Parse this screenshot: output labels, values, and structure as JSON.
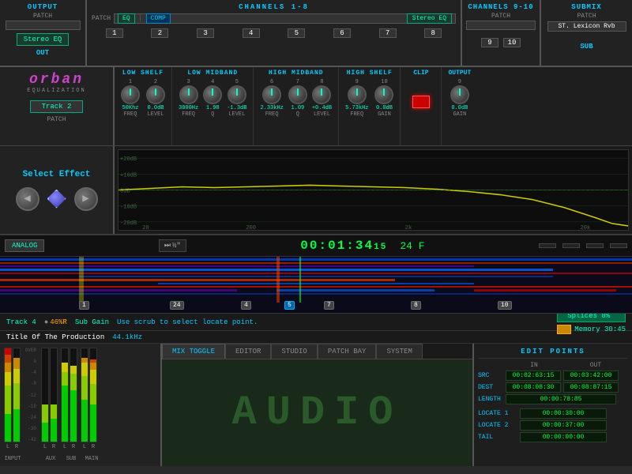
{
  "output": {
    "title": "OUTPUT",
    "patch_label": "PATCH",
    "patch_value": "",
    "eq_label": "Stereo EQ",
    "out_label": "OUT"
  },
  "channels_1_8": {
    "title": "CHANNELS 1-8",
    "patch_label": "PATCH",
    "eq_label": "EQ",
    "comp_label": "COMP",
    "stereo_eq": "Stereo EQ",
    "channels": [
      "1",
      "2",
      "3",
      "4",
      "5",
      "6",
      "7",
      "8"
    ]
  },
  "channels_9_10": {
    "title": "CHANNELS 9-10",
    "patch_label": "PATCH",
    "channels": [
      "9",
      "10"
    ]
  },
  "submix": {
    "title": "SUBMIX",
    "patch_label": "PATCH",
    "value": "ST. Lexicon Rvb",
    "sub_label": "SUB"
  },
  "orban": {
    "logo": "orban",
    "sub": "EQUALIZATION",
    "track": "Track 2",
    "patch": "PATCH"
  },
  "eq_bands": {
    "low_shelf": {
      "title": "LOW SHELF",
      "knob1": {
        "num": "1",
        "val": "50Khz",
        "label": "FREQ"
      },
      "knob2": {
        "num": "2",
        "val": "0.0dB",
        "label": "LEVEL"
      }
    },
    "low_mid": {
      "title": "LOW MIDBAND",
      "knob3": {
        "num": "3",
        "val": "3000Hz",
        "label": "FREQ"
      },
      "knob4": {
        "num": "4",
        "val": "1.98",
        "label": "Q"
      },
      "knob5": {
        "num": "5",
        "val": "-1.3dB",
        "label": "LEVEL"
      }
    },
    "high_mid": {
      "title": "HIGH MIDBAND",
      "knob6": {
        "num": "6",
        "val": "2.33kHz",
        "label": "FREQ"
      },
      "knob7": {
        "num": "7",
        "val": "1.09",
        "label": "Q"
      },
      "knob8": {
        "num": "8",
        "val": "+0.4dB",
        "label": "LEVEL"
      }
    },
    "high_shelf": {
      "title": "HIGH SHELF",
      "knob9": {
        "num": "9",
        "val": "5.73kHz",
        "label": "FREQ"
      },
      "knob10": {
        "num": "10",
        "val": "0.0dB",
        "label": "GAIN"
      }
    },
    "clip": {
      "title": "CLIP"
    },
    "output": {
      "title": "OUTPUT",
      "knob_val": "0.0dB",
      "knob_label": "GAIN",
      "knob_num": "9"
    }
  },
  "select_effect": {
    "label": "Select Effect"
  },
  "transport": {
    "analog_label": "ANALOG",
    "tape_label": "½\"",
    "timecode": "00:01:34",
    "frames": "15",
    "frame_unit": "24 F",
    "buttons": [
      "",
      "",
      "",
      "",
      "",
      ""
    ]
  },
  "timeline": {
    "markers": [
      "1",
      "24",
      "4",
      "5",
      "7",
      "8",
      "10"
    ]
  },
  "track_row": {
    "track": "Track 4",
    "percent": "46%R",
    "sub_gain": "Sub Gain",
    "status": "Use scrub to select locate point.",
    "splices": "Splices 8%",
    "memory": "Memory 30:45"
  },
  "title_row": {
    "title": "Title Of The Production",
    "hz": "44.1kHz"
  },
  "bottom_tabs": {
    "tabs": [
      "MIX TOGGLE",
      "EDITOR",
      "STUDIO",
      "PATCH BAY",
      "SYSTEM"
    ],
    "active": "MIX TOGGLE",
    "content": "AUDIO"
  },
  "edit_points": {
    "title": "EDIT POINTS",
    "in_label": "IN",
    "out_label": "OUT",
    "src_label": "SRC",
    "src_in": "00:02:63:15",
    "src_out": "00:03:42:00",
    "dest_label": "DEST",
    "dest_in": "00:08:08:30",
    "dest_out": "00:08:87:15",
    "length_label": "LENGTH",
    "length_val": "00:00:78:85",
    "locate1_label": "LOCATE 1",
    "locate1_val": "00:00:30:00",
    "locate2_label": "LOCATE 2",
    "locate2_val": "00:00:37:00",
    "tail_label": "TAIL",
    "tail_val": "00:00:00:00"
  },
  "vu": {
    "labels": [
      "L",
      "R",
      "L R",
      "L R",
      "L",
      "R"
    ],
    "section_labels": [
      "INPUT",
      "AUX",
      "SUB",
      "MAIN"
    ]
  }
}
